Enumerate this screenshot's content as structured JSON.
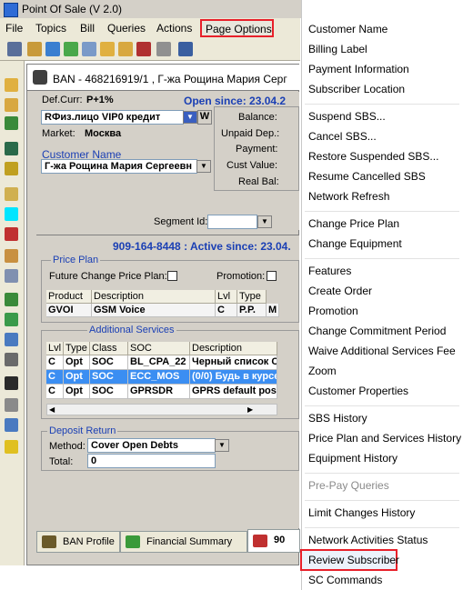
{
  "window": {
    "title": "Point Of Sale  (V 2.0)"
  },
  "menubar": {
    "items": [
      "File",
      "Topics",
      "Bill",
      "Queries",
      "Actions"
    ],
    "page_options": "Page Options"
  },
  "subscriber": {
    "title": "BAN - 468216919/1 , Г-жа Рощина Мария Серг",
    "def_curr_label": "Def.Curr:",
    "def_curr_value": "P+1%",
    "open_since": "Open since: 23.04.2",
    "account_type": "RФиз.лицо  VIP0  кредит",
    "w_button": "W",
    "market_label": "Market:",
    "market_value": "Москва",
    "customer_name_label": "Customer Name",
    "customer_name_value": "Г-жа Рощина Мария Сергеевн",
    "balance_label": "Balance:",
    "unpaid_label": "Unpaid Dep.:",
    "payment_label": "Payment:",
    "cust_value_label": "Cust Value:",
    "real_bal_label": "Real Bal:",
    "segment_label": "Segment Id:"
  },
  "line": {
    "header": "909-164-8448 : Active since: 23.04.",
    "price_plan_group": "Price Plan",
    "future_change_label": "Future Change Price Plan:",
    "promotion_label": "Promotion:",
    "pp_columns": [
      "Product",
      "Description",
      "Lvl",
      "Type"
    ],
    "pp_row": [
      "GVOI",
      "GSM Voice",
      "C",
      "P.P.",
      "M"
    ],
    "additional_services_label": "Additional Services",
    "as_columns": [
      "Lvl",
      "Type",
      "Class",
      "SOC",
      "Description"
    ],
    "as_rows": [
      [
        "C",
        "Opt",
        "SOC",
        "BL_CPA_22",
        "Черный список C"
      ],
      [
        "C",
        "Opt",
        "SOC",
        "ECC_MOS",
        "(0/0) Будь в курсе"
      ],
      [
        "C",
        "Opt",
        "SOC",
        "GPRSDR",
        "GPRS default pos"
      ]
    ],
    "deposit_return_group": "Deposit Return",
    "method_label": "Method:",
    "method_value": "Cover Open Debts",
    "total_label": "Total:",
    "total_value": "0"
  },
  "tabs": [
    "BAN Profile",
    "Financial Summary",
    "90"
  ],
  "page_options_menu": {
    "group1": [
      "Customer Name",
      "Billing Label",
      "Payment Information",
      "Subscriber Location"
    ],
    "group2": [
      "Suspend SBS...",
      "Cancel SBS...",
      "Restore Suspended SBS...",
      "Resume Cancelled SBS",
      "Network Refresh"
    ],
    "group3": [
      "Change Price Plan",
      "Change Equipment"
    ],
    "group4": [
      "Features",
      "Create Order",
      "Promotion",
      "Change Commitment Period",
      "Waive Additional Services Fee",
      "Zoom",
      "Customer Properties"
    ],
    "group5": [
      "SBS History",
      "Price Plan and Services History",
      "Equipment History"
    ],
    "group6_disabled": [
      "Pre-Pay Queries"
    ],
    "group7": [
      "Limit Changes History"
    ],
    "group8": [
      "Network Activities Status",
      "Review Subscriber",
      "SC Commands"
    ]
  },
  "colors": {
    "highlight_border": "#e8202a",
    "selection": "#3b8ef2",
    "label_blue": "#1a3fb4"
  }
}
